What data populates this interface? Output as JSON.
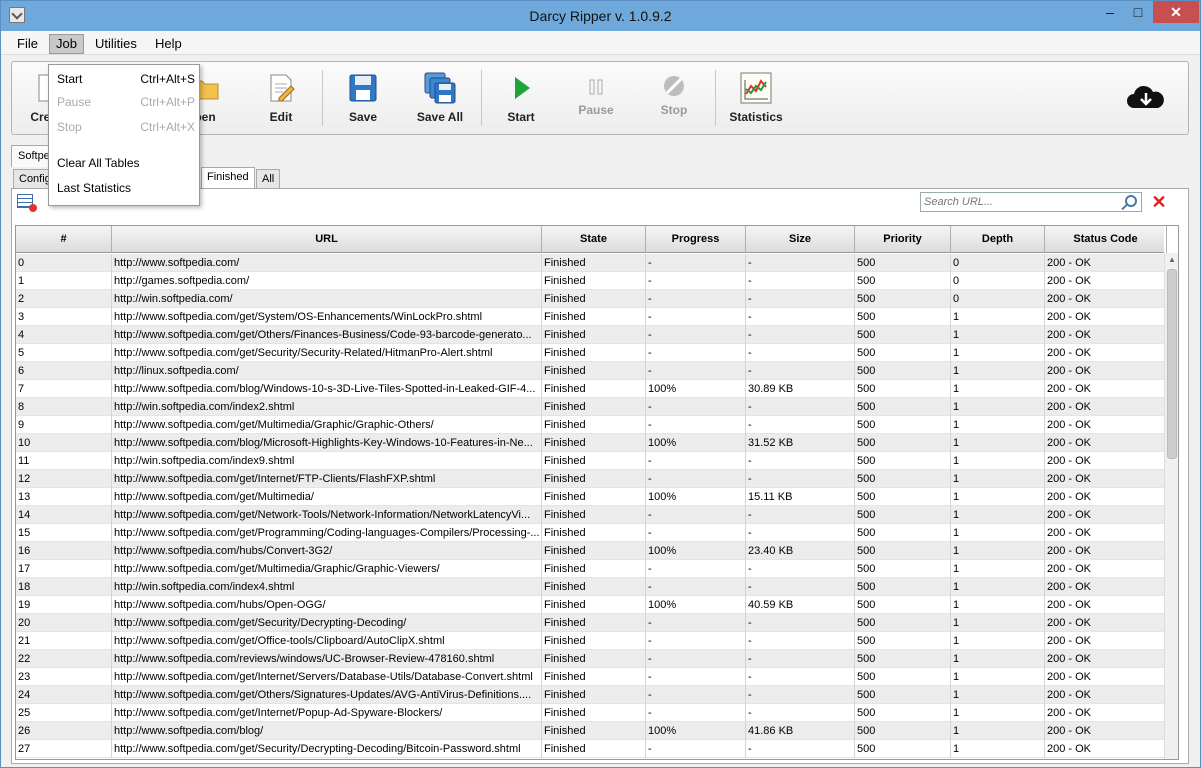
{
  "window": {
    "title": "Darcy Ripper v. 1.0.9.2"
  },
  "title_controls": {
    "minimize": "–",
    "maximize": "□",
    "close": "✕"
  },
  "menubar": [
    "File",
    "Job",
    "Utilities",
    "Help"
  ],
  "toolbar": {
    "create": "Create",
    "open": "pen",
    "edit": "Edit",
    "save": "Save",
    "save_all": "Save All",
    "start": "Start",
    "pause": "Pause",
    "stop": "Stop",
    "statistics": "Statistics"
  },
  "icons": {
    "start": "play-icon",
    "pause": "pause-icon",
    "stop": "stop-icon",
    "save": "floppy-icon",
    "save_all": "floppy-stack-icon",
    "edit": "document-edit-icon",
    "statistics": "chart-icon",
    "cloud": "cloud-download-icon"
  },
  "colors": {
    "title_bar": "#6fa9dc",
    "close_button": "#c74f4f",
    "play": "#1fa33a",
    "clear": "#d22222"
  },
  "job_tab": "Softpe",
  "subtabs": [
    "Config",
    "Finished",
    "All"
  ],
  "search": {
    "placeholder": "Search URL..."
  },
  "clear_glyph": "✕",
  "job_menu": {
    "items": [
      {
        "label": "Start",
        "shortcut": "Ctrl+Alt+S",
        "enabled": true
      },
      {
        "label": "Pause",
        "shortcut": "Ctrl+Alt+P",
        "enabled": false
      },
      {
        "label": "Stop",
        "shortcut": "Ctrl+Alt+X",
        "enabled": false
      },
      {
        "label": "Clear All Tables",
        "shortcut": "",
        "enabled": true
      },
      {
        "label": "Last Statistics",
        "shortcut": "",
        "enabled": true
      }
    ]
  },
  "table": {
    "columns": [
      "#",
      "URL",
      "State",
      "Progress",
      "Size",
      "Priority",
      "Depth",
      "Status Code"
    ],
    "rows": [
      [
        "0",
        "http://www.softpedia.com/",
        "Finished",
        "-",
        "-",
        "500",
        "0",
        "200 - OK"
      ],
      [
        "1",
        "http://games.softpedia.com/",
        "Finished",
        "-",
        "-",
        "500",
        "0",
        "200 - OK"
      ],
      [
        "2",
        "http://win.softpedia.com/",
        "Finished",
        "-",
        "-",
        "500",
        "0",
        "200 - OK"
      ],
      [
        "3",
        "http://www.softpedia.com/get/System/OS-Enhancements/WinLockPro.shtml",
        "Finished",
        "-",
        "-",
        "500",
        "1",
        "200 - OK"
      ],
      [
        "4",
        "http://www.softpedia.com/get/Others/Finances-Business/Code-93-barcode-generato...",
        "Finished",
        "-",
        "-",
        "500",
        "1",
        "200 - OK"
      ],
      [
        "5",
        "http://www.softpedia.com/get/Security/Security-Related/HitmanPro-Alert.shtml",
        "Finished",
        "-",
        "-",
        "500",
        "1",
        "200 - OK"
      ],
      [
        "6",
        "http://linux.softpedia.com/",
        "Finished",
        "-",
        "-",
        "500",
        "1",
        "200 - OK"
      ],
      [
        "7",
        "http://www.softpedia.com/blog/Windows-10-s-3D-Live-Tiles-Spotted-in-Leaked-GIF-4...",
        "Finished",
        "100%",
        "30.89 KB",
        "500",
        "1",
        "200 - OK"
      ],
      [
        "8",
        "http://win.softpedia.com/index2.shtml",
        "Finished",
        "-",
        "-",
        "500",
        "1",
        "200 - OK"
      ],
      [
        "9",
        "http://www.softpedia.com/get/Multimedia/Graphic/Graphic-Others/",
        "Finished",
        "-",
        "-",
        "500",
        "1",
        "200 - OK"
      ],
      [
        "10",
        "http://www.softpedia.com/blog/Microsoft-Highlights-Key-Windows-10-Features-in-Ne...",
        "Finished",
        "100%",
        "31.52 KB",
        "500",
        "1",
        "200 - OK"
      ],
      [
        "11",
        "http://win.softpedia.com/index9.shtml",
        "Finished",
        "-",
        "-",
        "500",
        "1",
        "200 - OK"
      ],
      [
        "12",
        "http://www.softpedia.com/get/Internet/FTP-Clients/FlashFXP.shtml",
        "Finished",
        "-",
        "-",
        "500",
        "1",
        "200 - OK"
      ],
      [
        "13",
        "http://www.softpedia.com/get/Multimedia/",
        "Finished",
        "100%",
        "15.11 KB",
        "500",
        "1",
        "200 - OK"
      ],
      [
        "14",
        "http://www.softpedia.com/get/Network-Tools/Network-Information/NetworkLatencyVi...",
        "Finished",
        "-",
        "-",
        "500",
        "1",
        "200 - OK"
      ],
      [
        "15",
        "http://www.softpedia.com/get/Programming/Coding-languages-Compilers/Processing-...",
        "Finished",
        "-",
        "-",
        "500",
        "1",
        "200 - OK"
      ],
      [
        "16",
        "http://www.softpedia.com/hubs/Convert-3G2/",
        "Finished",
        "100%",
        "23.40 KB",
        "500",
        "1",
        "200 - OK"
      ],
      [
        "17",
        "http://www.softpedia.com/get/Multimedia/Graphic/Graphic-Viewers/",
        "Finished",
        "-",
        "-",
        "500",
        "1",
        "200 - OK"
      ],
      [
        "18",
        "http://win.softpedia.com/index4.shtml",
        "Finished",
        "-",
        "-",
        "500",
        "1",
        "200 - OK"
      ],
      [
        "19",
        "http://www.softpedia.com/hubs/Open-OGG/",
        "Finished",
        "100%",
        "40.59 KB",
        "500",
        "1",
        "200 - OK"
      ],
      [
        "20",
        "http://www.softpedia.com/get/Security/Decrypting-Decoding/",
        "Finished",
        "-",
        "-",
        "500",
        "1",
        "200 - OK"
      ],
      [
        "21",
        "http://www.softpedia.com/get/Office-tools/Clipboard/AutoClipX.shtml",
        "Finished",
        "-",
        "-",
        "500",
        "1",
        "200 - OK"
      ],
      [
        "22",
        "http://www.softpedia.com/reviews/windows/UC-Browser-Review-478160.shtml",
        "Finished",
        "-",
        "-",
        "500",
        "1",
        "200 - OK"
      ],
      [
        "23",
        "http://www.softpedia.com/get/Internet/Servers/Database-Utils/Database-Convert.shtml",
        "Finished",
        "-",
        "-",
        "500",
        "1",
        "200 - OK"
      ],
      [
        "24",
        "http://www.softpedia.com/get/Others/Signatures-Updates/AVG-AntiVirus-Definitions....",
        "Finished",
        "-",
        "-",
        "500",
        "1",
        "200 - OK"
      ],
      [
        "25",
        "http://www.softpedia.com/get/Internet/Popup-Ad-Spyware-Blockers/",
        "Finished",
        "-",
        "-",
        "500",
        "1",
        "200 - OK"
      ],
      [
        "26",
        "http://www.softpedia.com/blog/",
        "Finished",
        "100%",
        "41.86 KB",
        "500",
        "1",
        "200 - OK"
      ],
      [
        "27",
        "http://www.softpedia.com/get/Security/Decrypting-Decoding/Bitcoin-Password.shtml",
        "Finished",
        "-",
        "-",
        "500",
        "1",
        "200 - OK"
      ]
    ]
  }
}
